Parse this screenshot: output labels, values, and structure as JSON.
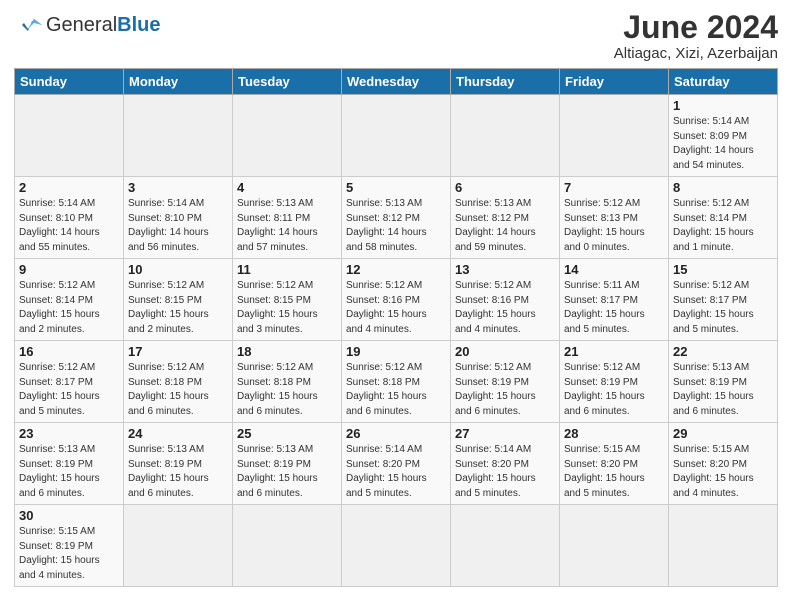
{
  "header": {
    "title": "June 2024",
    "subtitle": "Altiagac, Xizi, Azerbaijan",
    "logo_general": "General",
    "logo_blue": "Blue"
  },
  "days_of_week": [
    "Sunday",
    "Monday",
    "Tuesday",
    "Wednesday",
    "Thursday",
    "Friday",
    "Saturday"
  ],
  "weeks": [
    [
      {
        "day": "",
        "info": ""
      },
      {
        "day": "",
        "info": ""
      },
      {
        "day": "",
        "info": ""
      },
      {
        "day": "",
        "info": ""
      },
      {
        "day": "",
        "info": ""
      },
      {
        "day": "",
        "info": ""
      },
      {
        "day": "1",
        "info": "Sunrise: 5:14 AM\nSunset: 8:09 PM\nDaylight: 14 hours\nand 54 minutes."
      }
    ],
    [
      {
        "day": "2",
        "info": "Sunrise: 5:14 AM\nSunset: 8:10 PM\nDaylight: 14 hours\nand 55 minutes."
      },
      {
        "day": "3",
        "info": "Sunrise: 5:14 AM\nSunset: 8:10 PM\nDaylight: 14 hours\nand 56 minutes."
      },
      {
        "day": "4",
        "info": "Sunrise: 5:13 AM\nSunset: 8:11 PM\nDaylight: 14 hours\nand 57 minutes."
      },
      {
        "day": "5",
        "info": "Sunrise: 5:13 AM\nSunset: 8:12 PM\nDaylight: 14 hours\nand 58 minutes."
      },
      {
        "day": "6",
        "info": "Sunrise: 5:13 AM\nSunset: 8:12 PM\nDaylight: 14 hours\nand 59 minutes."
      },
      {
        "day": "7",
        "info": "Sunrise: 5:12 AM\nSunset: 8:13 PM\nDaylight: 15 hours\nand 0 minutes."
      },
      {
        "day": "8",
        "info": "Sunrise: 5:12 AM\nSunset: 8:14 PM\nDaylight: 15 hours\nand 1 minute."
      }
    ],
    [
      {
        "day": "9",
        "info": "Sunrise: 5:12 AM\nSunset: 8:14 PM\nDaylight: 15 hours\nand 2 minutes."
      },
      {
        "day": "10",
        "info": "Sunrise: 5:12 AM\nSunset: 8:15 PM\nDaylight: 15 hours\nand 2 minutes."
      },
      {
        "day": "11",
        "info": "Sunrise: 5:12 AM\nSunset: 8:15 PM\nDaylight: 15 hours\nand 3 minutes."
      },
      {
        "day": "12",
        "info": "Sunrise: 5:12 AM\nSunset: 8:16 PM\nDaylight: 15 hours\nand 4 minutes."
      },
      {
        "day": "13",
        "info": "Sunrise: 5:12 AM\nSunset: 8:16 PM\nDaylight: 15 hours\nand 4 minutes."
      },
      {
        "day": "14",
        "info": "Sunrise: 5:11 AM\nSunset: 8:17 PM\nDaylight: 15 hours\nand 5 minutes."
      },
      {
        "day": "15",
        "info": "Sunrise: 5:12 AM\nSunset: 8:17 PM\nDaylight: 15 hours\nand 5 minutes."
      }
    ],
    [
      {
        "day": "16",
        "info": "Sunrise: 5:12 AM\nSunset: 8:17 PM\nDaylight: 15 hours\nand 5 minutes."
      },
      {
        "day": "17",
        "info": "Sunrise: 5:12 AM\nSunset: 8:18 PM\nDaylight: 15 hours\nand 6 minutes."
      },
      {
        "day": "18",
        "info": "Sunrise: 5:12 AM\nSunset: 8:18 PM\nDaylight: 15 hours\nand 6 minutes."
      },
      {
        "day": "19",
        "info": "Sunrise: 5:12 AM\nSunset: 8:18 PM\nDaylight: 15 hours\nand 6 minutes."
      },
      {
        "day": "20",
        "info": "Sunrise: 5:12 AM\nSunset: 8:19 PM\nDaylight: 15 hours\nand 6 minutes."
      },
      {
        "day": "21",
        "info": "Sunrise: 5:12 AM\nSunset: 8:19 PM\nDaylight: 15 hours\nand 6 minutes."
      },
      {
        "day": "22",
        "info": "Sunrise: 5:13 AM\nSunset: 8:19 PM\nDaylight: 15 hours\nand 6 minutes."
      }
    ],
    [
      {
        "day": "23",
        "info": "Sunrise: 5:13 AM\nSunset: 8:19 PM\nDaylight: 15 hours\nand 6 minutes."
      },
      {
        "day": "24",
        "info": "Sunrise: 5:13 AM\nSunset: 8:19 PM\nDaylight: 15 hours\nand 6 minutes."
      },
      {
        "day": "25",
        "info": "Sunrise: 5:13 AM\nSunset: 8:19 PM\nDaylight: 15 hours\nand 6 minutes."
      },
      {
        "day": "26",
        "info": "Sunrise: 5:14 AM\nSunset: 8:20 PM\nDaylight: 15 hours\nand 5 minutes."
      },
      {
        "day": "27",
        "info": "Sunrise: 5:14 AM\nSunset: 8:20 PM\nDaylight: 15 hours\nand 5 minutes."
      },
      {
        "day": "28",
        "info": "Sunrise: 5:15 AM\nSunset: 8:20 PM\nDaylight: 15 hours\nand 5 minutes."
      },
      {
        "day": "29",
        "info": "Sunrise: 5:15 AM\nSunset: 8:20 PM\nDaylight: 15 hours\nand 4 minutes."
      }
    ],
    [
      {
        "day": "30",
        "info": "Sunrise: 5:15 AM\nSunset: 8:19 PM\nDaylight: 15 hours\nand 4 minutes."
      },
      {
        "day": "",
        "info": ""
      },
      {
        "day": "",
        "info": ""
      },
      {
        "day": "",
        "info": ""
      },
      {
        "day": "",
        "info": ""
      },
      {
        "day": "",
        "info": ""
      },
      {
        "day": "",
        "info": ""
      }
    ]
  ]
}
